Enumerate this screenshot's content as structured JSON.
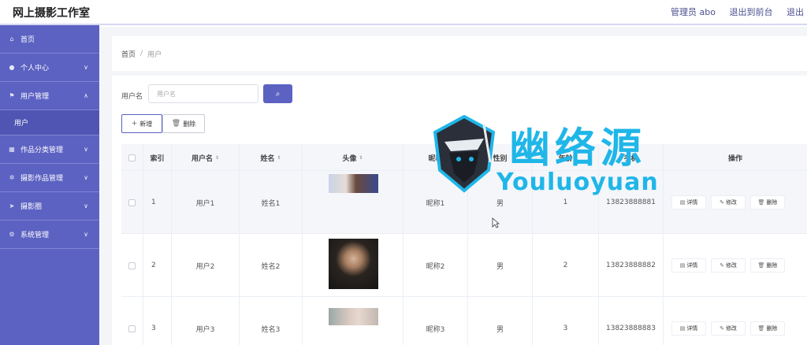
{
  "header": {
    "app_title": "网上摄影工作室",
    "admin_label": "管理员 abo",
    "front_link": "退出到前台",
    "logout_link": "退出"
  },
  "sidebar": {
    "items": [
      {
        "label": "首页",
        "icon": "home-icon"
      },
      {
        "label": "个人中心",
        "icon": "user-icon"
      },
      {
        "label": "用户管理",
        "icon": "flag-icon",
        "expanded": true,
        "children": [
          "用户"
        ]
      },
      {
        "label": "作品分类管理",
        "icon": "grid-icon"
      },
      {
        "label": "摄影作品管理",
        "icon": "gear-icon"
      },
      {
        "label": "摄影圈",
        "icon": "send-icon"
      },
      {
        "label": "系统管理",
        "icon": "cog-icon"
      }
    ]
  },
  "breadcrumb": {
    "home": "首页",
    "current": "用户"
  },
  "search": {
    "label": "用户名",
    "placeholder": "用户名"
  },
  "toolbar": {
    "add_label": "新增",
    "delete_label": "删除"
  },
  "table": {
    "headers": [
      "索引",
      "用户名",
      "姓名",
      "头像",
      "昵称",
      "性别",
      "年龄",
      "手机",
      "操作"
    ],
    "rows": [
      {
        "index": "1",
        "username": "用户1",
        "name": "姓名1",
        "nickname": "昵称1",
        "gender": "男",
        "age": "1",
        "phone": "13823888881"
      },
      {
        "index": "2",
        "username": "用户2",
        "name": "姓名2",
        "nickname": "昵称2",
        "gender": "男",
        "age": "2",
        "phone": "13823888882"
      },
      {
        "index": "3",
        "username": "用户3",
        "name": "姓名3",
        "nickname": "昵称3",
        "gender": "男",
        "age": "3",
        "phone": "13823888883"
      }
    ],
    "actions": {
      "detail": "详情",
      "edit": "修改",
      "delete": "删除"
    }
  },
  "watermark": {
    "cn": "幽络源",
    "en": "Youluoyuan"
  },
  "colors": {
    "primary": "#5c62c2",
    "watermark": "#1fb6e8"
  }
}
